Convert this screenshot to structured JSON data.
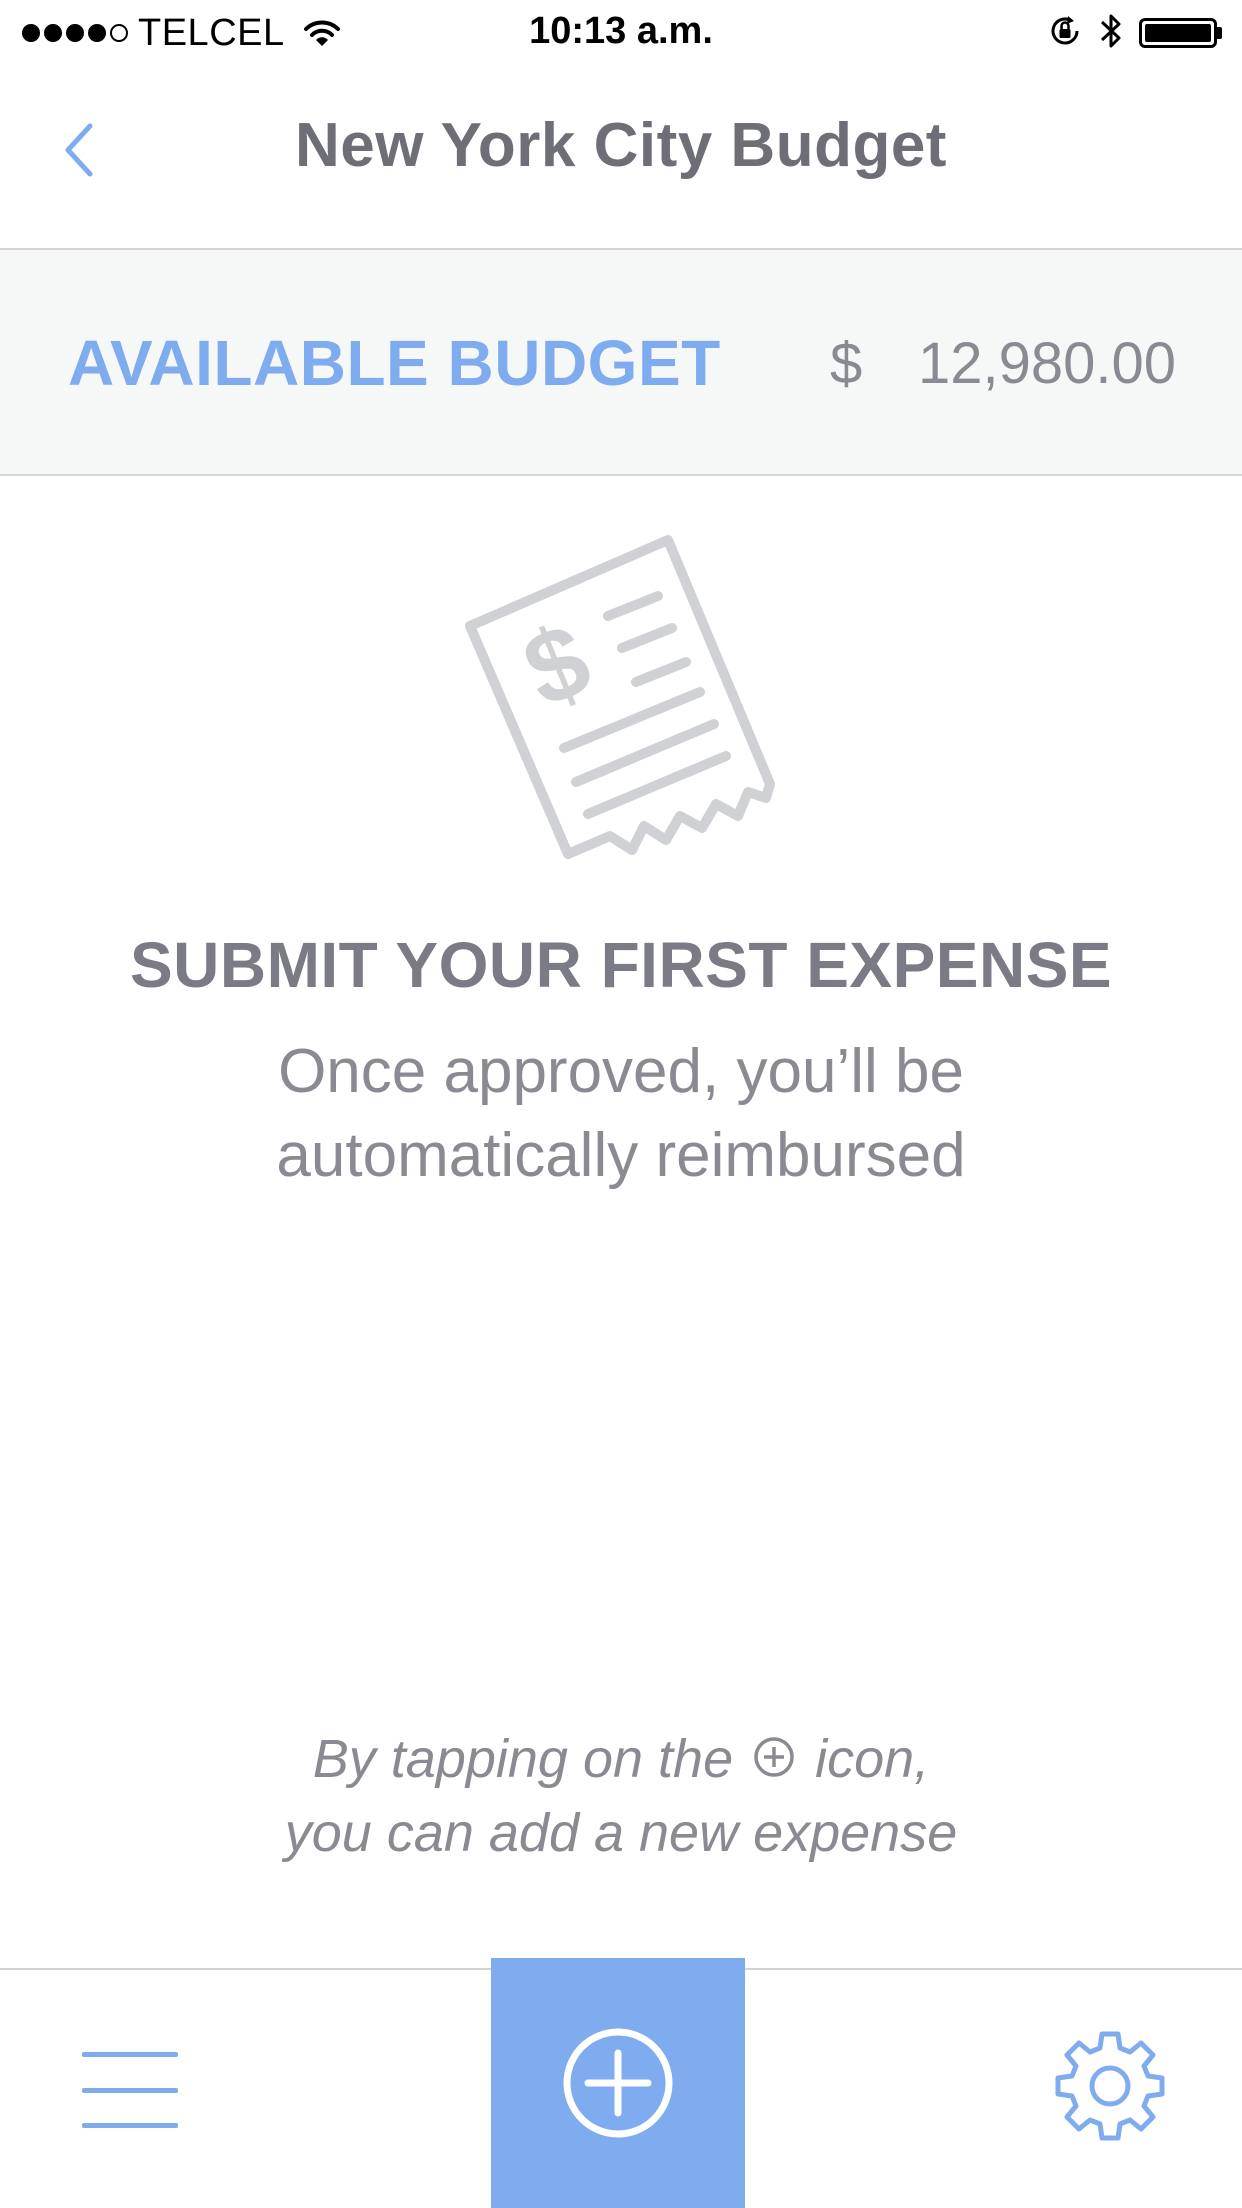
{
  "status_bar": {
    "carrier": "TELCEL",
    "time": "10:13 a.m.",
    "signal_bars_filled": 4,
    "signal_bars_total": 5,
    "battery_level": 1.0
  },
  "nav": {
    "title": "New York City Budget",
    "back_icon": "chevron-left-icon"
  },
  "budget": {
    "label": "AVAILABLE BUDGET",
    "currency": "$",
    "amount": "12,980.00"
  },
  "empty_state": {
    "icon": "receipt-icon",
    "title": "SUBMIT YOUR FIRST EXPENSE",
    "subtitle_line1": "Once approved, you’ll be",
    "subtitle_line2": "automatically reimbursed"
  },
  "hint": {
    "line1_before": "By tapping on the",
    "line1_after": "icon,",
    "line2": "you can add a new expense"
  },
  "tab_bar": {
    "menu_icon": "hamburger-menu-icon",
    "add_icon": "add-circle-icon",
    "settings_icon": "gear-icon"
  },
  "colors": {
    "accent": "#7fabef",
    "text_gray": "#8a8a93",
    "title_gray": "#6d6e76",
    "budget_bg": "#f6f7f7",
    "divider": "#d3d4d8",
    "icon_gray": "#cfd1d5"
  }
}
